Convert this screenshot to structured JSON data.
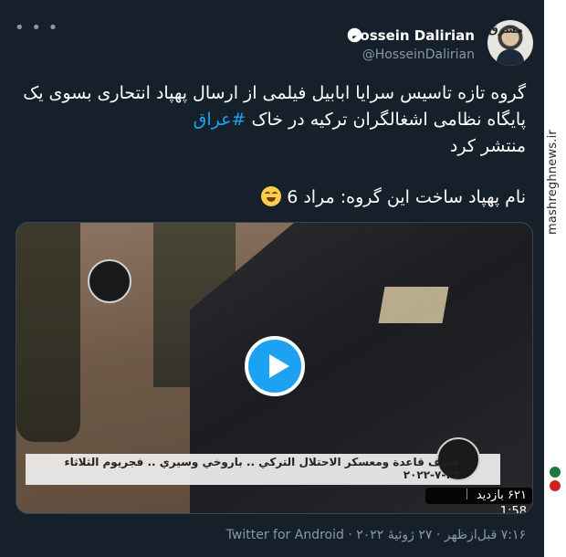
{
  "author": {
    "name": "Hossein Dalirian",
    "handle": "@HosseinDalirian",
    "verified": true
  },
  "tweet": {
    "text_main": "گروه تازه تاسیس سرایا ابابیل فیلمی از ارسال پهپاد انتحاری بسوی یک پایگاه نظامی اشغالگران ترکیه در خاک",
    "hashtag": "#عراق",
    "text_tail": "منتشر کرد",
    "text_second": "نام پهپاد ساخت این گروه: مراد 6"
  },
  "media": {
    "banner_text": "قصف قاعدة ومعسكر الاحتلال التركي .. باروخي وسيري .. فجريوم الثلاثاء ٢٦-٧-٢٠٢٢",
    "duration": "1:58",
    "views": "۶۲۱ بازدید"
  },
  "footer": {
    "meta": "۷:۱۶ قبل‌ازظهر · ۲۷ ژوئیهٔ ۲۰۲۲ · Twitter for Android"
  },
  "watermark": {
    "site": "mashreghnews.ir",
    "logo": "مشرق"
  },
  "colors": {
    "background": "#15202b",
    "accent": "#1da1f2",
    "muted": "#8899a6"
  }
}
